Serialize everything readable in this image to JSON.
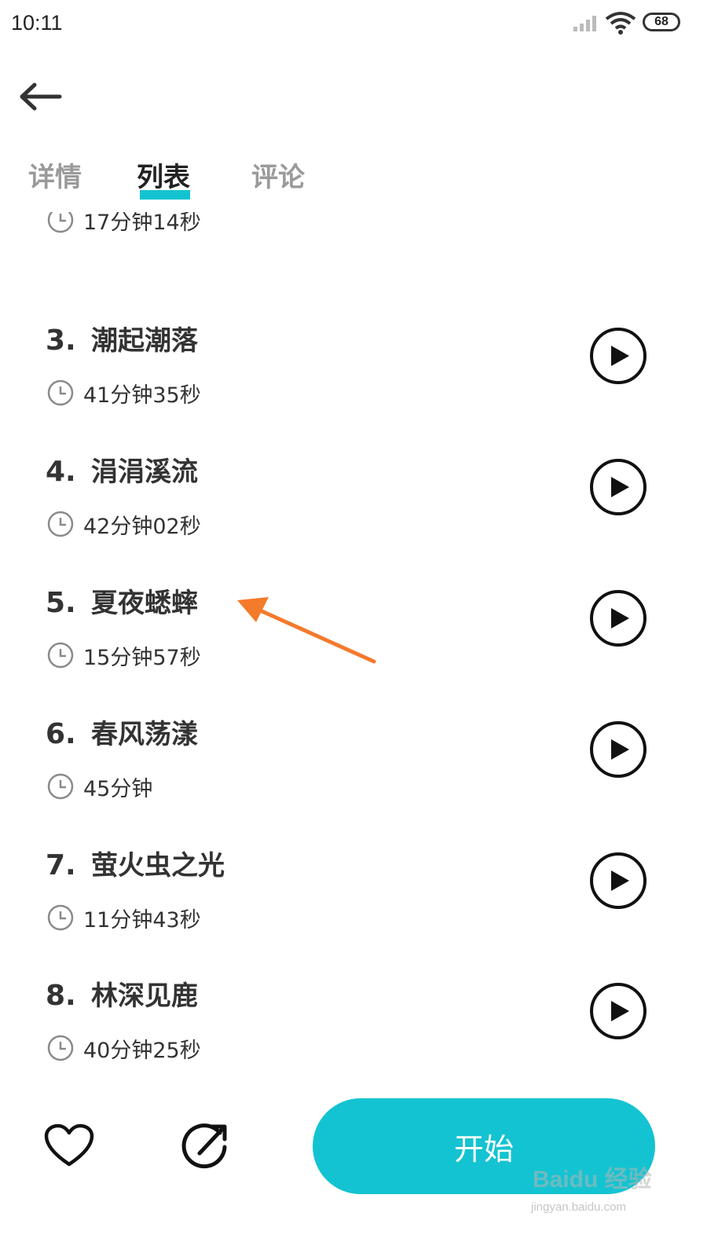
{
  "status_bar": {
    "time": "10:11",
    "battery": "68"
  },
  "tabs": [
    {
      "label": "详情",
      "active": false
    },
    {
      "label": "列表",
      "active": true
    },
    {
      "label": "评论",
      "active": false
    }
  ],
  "list": {
    "items": [
      {
        "number": "",
        "title": "",
        "duration": "17分钟14秒"
      },
      {
        "number": "3.",
        "title": "潮起潮落",
        "duration": "41分钟35秒"
      },
      {
        "number": "4.",
        "title": "涓涓溪流",
        "duration": "42分钟02秒"
      },
      {
        "number": "5.",
        "title": "夏夜蟋蟀",
        "duration": "15分钟57秒"
      },
      {
        "number": "6.",
        "title": "春风荡漾",
        "duration": "45分钟"
      },
      {
        "number": "7.",
        "title": "萤火虫之光",
        "duration": "11分钟43秒"
      },
      {
        "number": "8.",
        "title": "林深见鹿",
        "duration": "40分钟25秒"
      }
    ]
  },
  "bottom_bar": {
    "start_label": "开始"
  },
  "watermark": {
    "brand": "Baidu 经验",
    "site": "jingyan.baidu.com"
  },
  "colors": {
    "accent": "#14c3d1",
    "annotation": "#f47a2c"
  },
  "icons": [
    "back-arrow-icon",
    "clock-icon",
    "play-icon",
    "heart-icon",
    "share-icon"
  ]
}
